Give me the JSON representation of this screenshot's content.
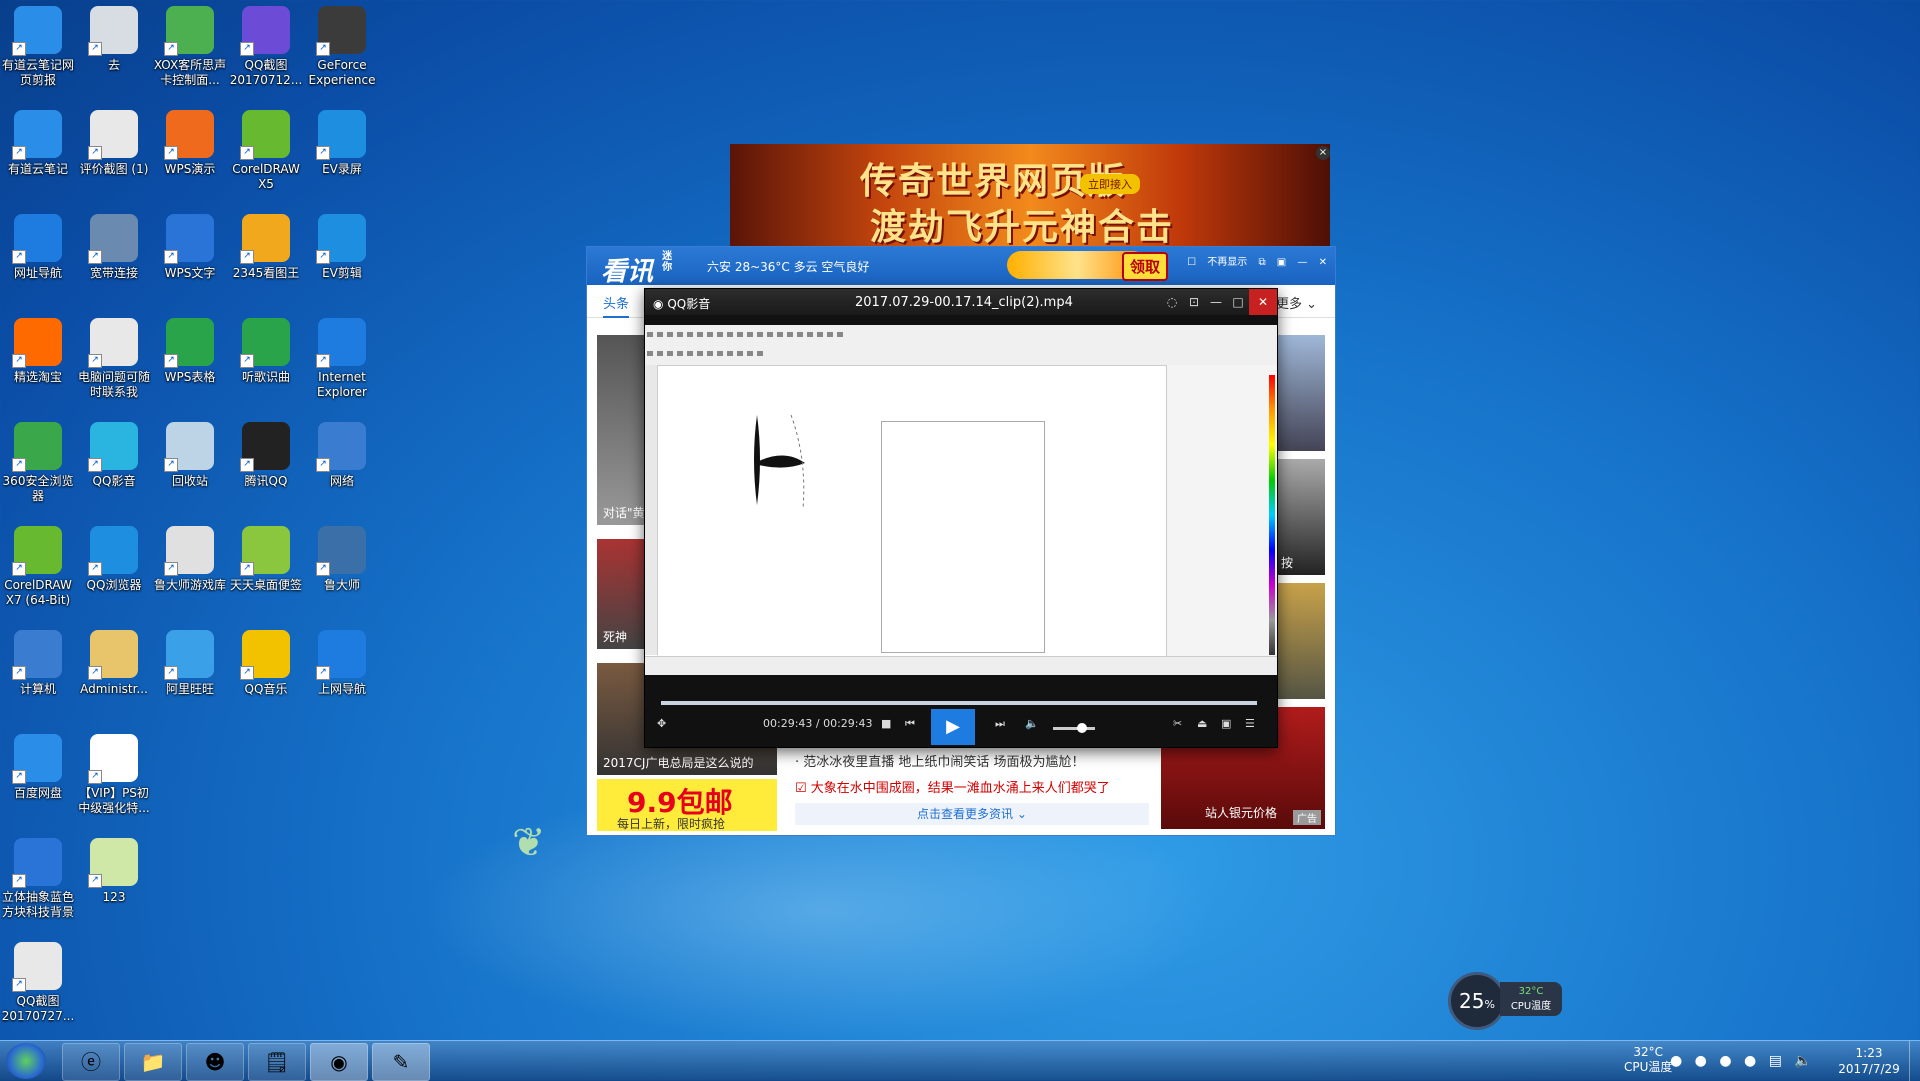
{
  "desktop": {
    "icons": [
      {
        "label": "有道云笔记网页剪报",
        "icon": "youdao-clip-icon",
        "color": "#2a8ee8"
      },
      {
        "label": "去",
        "icon": "blank-window-icon",
        "color": "#d8dde3"
      },
      {
        "label": "XOX客所思声卡控制面...",
        "icon": "xox-soundcard-icon",
        "color": "#4caf50"
      },
      {
        "label": "QQ截图20170712...",
        "icon": "qq-screenshot-icon",
        "color": "#6c4bd6"
      },
      {
        "label": "GeForce Experience",
        "icon": "geforce-icon",
        "color": "#3b3b3b"
      },
      {
        "label": "有道云笔记",
        "icon": "youdao-note-icon",
        "color": "#2a8ee8"
      },
      {
        "label": "评价截图 (1)",
        "icon": "image-file-icon",
        "color": "#e8e8e8"
      },
      {
        "label": "WPS演示",
        "icon": "wps-presentation-icon",
        "color": "#f06a1d"
      },
      {
        "label": "CorelDRAW X5",
        "icon": "coreldraw-icon",
        "color": "#67b92f"
      },
      {
        "label": "EV录屏",
        "icon": "ev-record-icon",
        "color": "#1e8fe0"
      },
      {
        "label": "网址导航",
        "icon": "ie-icon",
        "color": "#1e7be0"
      },
      {
        "label": "宽带连接",
        "icon": "network-icon",
        "color": "#6a8ab0"
      },
      {
        "label": "WPS文字",
        "icon": "wps-writer-icon",
        "color": "#2a74d8"
      },
      {
        "label": "2345看图王",
        "icon": "image-viewer-icon",
        "color": "#f2a81d"
      },
      {
        "label": "EV剪辑",
        "icon": "ev-edit-icon",
        "color": "#1e8fe0"
      },
      {
        "label": "精选淘宝",
        "icon": "taobao-icon",
        "color": "#ff6a00"
      },
      {
        "label": "电脑问题可随时联系我",
        "icon": "text-file-icon",
        "color": "#e8e8e8"
      },
      {
        "label": "WPS表格",
        "icon": "wps-spreadsheet-icon",
        "color": "#2aa44a"
      },
      {
        "label": "听歌识曲",
        "icon": "music-id-icon",
        "color": "#2aa44a"
      },
      {
        "label": "Internet Explorer",
        "icon": "ie-icon",
        "color": "#1e7be0"
      },
      {
        "label": "360安全浏览器",
        "icon": "browser-360-icon",
        "color": "#3aa84a"
      },
      {
        "label": "QQ影音",
        "icon": "qq-player-icon",
        "color": "#2ab4e0"
      },
      {
        "label": "回收站",
        "icon": "recycle-bin-icon",
        "color": "#bcd4e6"
      },
      {
        "label": "腾讯QQ",
        "icon": "qq-penguin-icon",
        "color": "#222222"
      },
      {
        "label": "网络",
        "icon": "globe-icon",
        "color": "#3a7cd0"
      },
      {
        "label": "CorelDRAW X7 (64-Bit)",
        "icon": "coreldraw-icon",
        "color": "#67b92f"
      },
      {
        "label": "QQ浏览器",
        "icon": "qq-browser-icon",
        "color": "#1e8fe0"
      },
      {
        "label": "鲁大师游戏库",
        "icon": "gamepad-icon",
        "color": "#e0e0e0"
      },
      {
        "label": "天天桌面便签",
        "icon": "sticky-note-icon",
        "color": "#8ac63e"
      },
      {
        "label": "鲁大师",
        "icon": "ludashi-icon",
        "color": "#3a6fa8"
      },
      {
        "label": "计算机",
        "icon": "computer-icon",
        "color": "#3a7cd0"
      },
      {
        "label": "Administr...",
        "icon": "user-folder-icon",
        "color": "#e8c46a"
      },
      {
        "label": "阿里旺旺",
        "icon": "aliwangwang-icon",
        "color": "#3aa0e8"
      },
      {
        "label": "QQ音乐",
        "icon": "qq-music-icon",
        "color": "#f2c200"
      },
      {
        "label": "上网导航",
        "icon": "ie-icon",
        "color": "#1e7be0"
      },
      {
        "label": "百度网盘",
        "icon": "baidu-pan-icon",
        "color": "#2a8ee8"
      },
      {
        "label": "【VIP】PS初中级强化特...",
        "icon": "text-file-icon",
        "color": "#ffffff"
      },
      {
        "label": "立体抽象蓝色方块科技背景",
        "icon": "image-file-icon",
        "color": "#2a74d8"
      },
      {
        "label": "123",
        "icon": "cdr-file-icon",
        "color": "#cfe8a8"
      },
      {
        "label": "QQ截图20170727...",
        "icon": "image-file-icon",
        "color": "#e8e8e8"
      }
    ]
  },
  "ad_banner": {
    "line1": "传奇世界网页版",
    "line2": "渡劫飞升元神合击",
    "button": "立即接入",
    "close": "×"
  },
  "news_window": {
    "logo": "看讯",
    "logo_small": "迷你",
    "weather": "六安 28~36°C 多云 空气良好",
    "promo_button": "领取",
    "no_show_label": "不再显示",
    "active_tab": "头条",
    "more_tab": "更多",
    "image_caption_1": "对话\"黄",
    "image_caption_2": "死神",
    "image_caption_3": "2017CJ广电总局是这么说的",
    "headline_1": "范冰冰夜里直播 地上纸巾闹笑话 场面极为尴尬！",
    "headline_2": "大象在水中围成圈，结果一滩血水涌上来人们都哭了",
    "more_news": "点击查看更多资讯",
    "right_caption_1": "按",
    "coin_caption": "站人银元价格",
    "ad_badge": "广告",
    "promo99_big": "9.9包邮",
    "promo99_small": "每日上新，限时疯抢"
  },
  "player": {
    "app_name": "QQ影音",
    "file_name": "2017.07.29-00.17.14_clip(2).mp4",
    "time": "00:29:43 / 00:29:43",
    "progress_fraction": 1.0,
    "volume_fraction": 0.7
  },
  "widget": {
    "cpu_percent": "25",
    "percent_sign": "%",
    "cpu_temp": "32°C",
    "cpu_temp_label": "CPU温度"
  },
  "taskbar": {
    "temp": "32°C",
    "temp_label": "CPU温度",
    "time": "1:23",
    "date": "2017/7/29"
  }
}
